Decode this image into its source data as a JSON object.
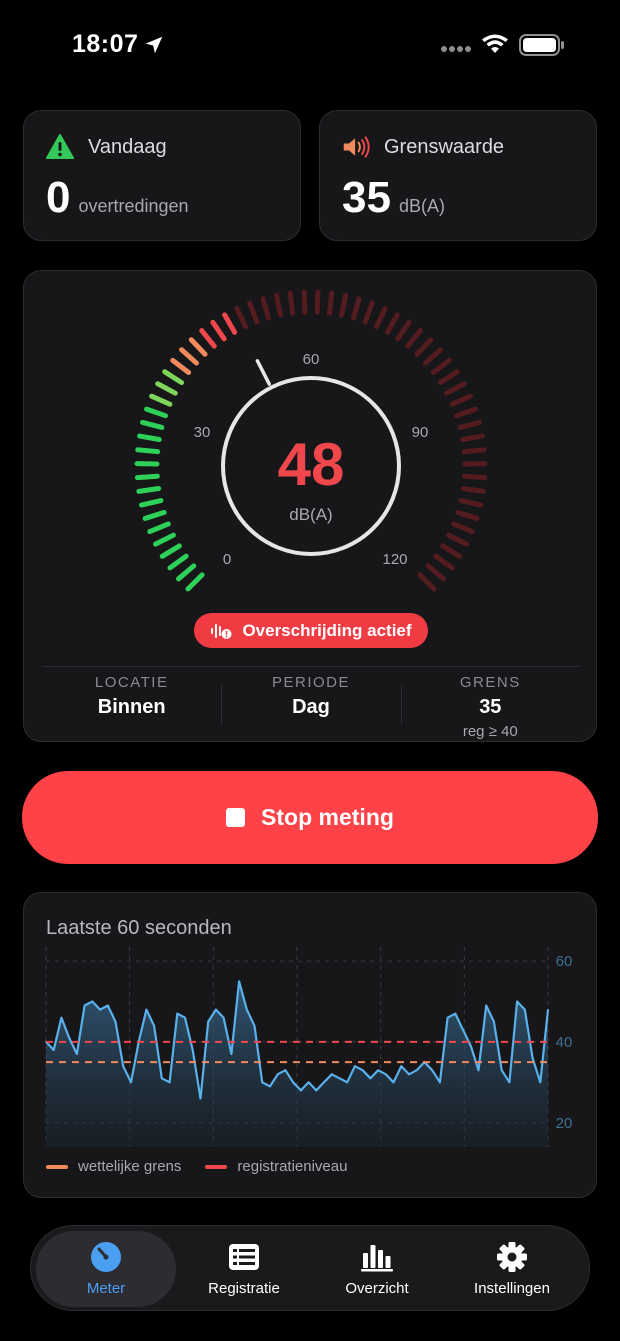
{
  "status_bar": {
    "time": "18:07"
  },
  "stats": {
    "today": {
      "title": "Vandaag",
      "value": "0",
      "unit": "overtredingen"
    },
    "limit": {
      "title": "Grenswaarde",
      "value": "35",
      "unit": "dB(A)"
    }
  },
  "meter": {
    "value": "48",
    "unit": "dB(A)",
    "level": 48,
    "scale": [
      "0",
      "30",
      "60",
      "90",
      "120"
    ],
    "badge": "Overschrijding actief",
    "info": [
      {
        "label": "LOCATIE",
        "value": "Binnen",
        "sub": ""
      },
      {
        "label": "PERIODE",
        "value": "Dag",
        "sub": ""
      },
      {
        "label": "GRENS",
        "value": "35",
        "sub": "reg ≥ 40"
      }
    ]
  },
  "stop_button": {
    "label": "Stop meting"
  },
  "chart": {
    "title": "Laatste 60 seconden",
    "legend": {
      "limit": "wettelijke grens",
      "registration": "registratieniveau"
    }
  },
  "chart_data": {
    "type": "area",
    "ylim": [
      14,
      62
    ],
    "yticks": [
      20,
      40,
      60
    ],
    "grid": true,
    "limit_line": 35,
    "registration_line": 40,
    "values": [
      40,
      38,
      46,
      41,
      37,
      49,
      50,
      48,
      49,
      45,
      34,
      30,
      40,
      48,
      44,
      31,
      30,
      47,
      46,
      38,
      26,
      45,
      48,
      46,
      37,
      55,
      48,
      44,
      30,
      29,
      32,
      33,
      30,
      28,
      30,
      28,
      30,
      32,
      31,
      30,
      34,
      33,
      31,
      33,
      32,
      30,
      34,
      32,
      33,
      35,
      33,
      30,
      46,
      47,
      43,
      39,
      33,
      49,
      45,
      33,
      30,
      50,
      48,
      36,
      30,
      48
    ],
    "colors": {
      "series": "#5ab0ea",
      "limit": "#f08a5d",
      "registration": "#f0474c"
    }
  },
  "tabs": [
    {
      "label": "Meter",
      "icon": "gauge-icon"
    },
    {
      "label": "Registratie",
      "icon": "list-icon"
    },
    {
      "label": "Overzicht",
      "icon": "bar-chart-icon"
    },
    {
      "label": "Instellingen",
      "icon": "gear-icon"
    }
  ]
}
